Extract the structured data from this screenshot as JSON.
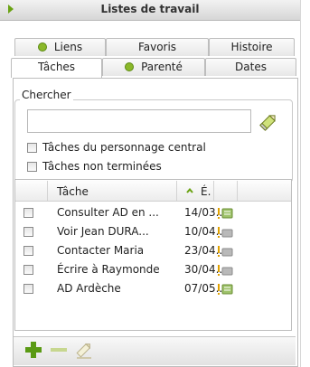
{
  "window": {
    "title": "Listes de travail"
  },
  "tabs_row1": [
    {
      "label": "Liens",
      "dot": true
    },
    {
      "label": "Favoris",
      "dot": false
    },
    {
      "label": "Histoire",
      "dot": false
    }
  ],
  "tabs_row2": [
    {
      "label": "Tâches",
      "dot": false,
      "active": true
    },
    {
      "label": "Parenté",
      "dot": true
    },
    {
      "label": "Dates",
      "dot": false
    }
  ],
  "search": {
    "legend": "Chercher",
    "value": "",
    "placeholder": "",
    "filter_central": "Tâches du personnage central",
    "filter_unfinished": "Tâches non terminées"
  },
  "table": {
    "columns": [
      "Tâche",
      "É."
    ],
    "rows": [
      {
        "task": "Consulter AD en ...",
        "date": "14/03..."
      },
      {
        "task": "Voir Jean DURA...",
        "date": "10/04..."
      },
      {
        "task": "Contacter Maria",
        "date": "23/04..."
      },
      {
        "task": "Écrire à Raymonde",
        "date": "30/04..."
      },
      {
        "task": "AD Ardèche",
        "date": "07/05..."
      }
    ]
  },
  "colors": {
    "accent": "#6aa313",
    "priority": "#e0a100",
    "dot": "#8bb82a"
  },
  "icons": [
    "chevron-right-icon",
    "pencil-icon",
    "sort-up-icon",
    "priority-icon",
    "add-icon",
    "remove-icon",
    "edit-icon"
  ]
}
